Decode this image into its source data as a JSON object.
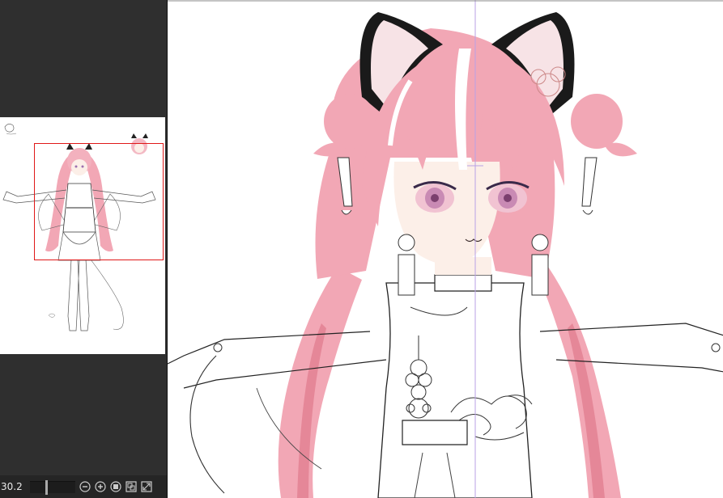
{
  "navigator": {
    "zoom_value": "30.2",
    "zoom_level": 0.36,
    "icons": [
      "zoom-out-icon",
      "zoom-in-icon",
      "fit-icon",
      "actual-size-icon",
      "fit-window-icon"
    ]
  },
  "colors": {
    "panel_bg": "#2f2f2f",
    "canvas_bg": "#ffffff",
    "navigator_frame": "#e01818",
    "hair_pink": "#f2a7b5",
    "hair_shadow": "#e58798",
    "guide_line": "#b9a0e6",
    "ear_black": "#1a1a1a",
    "skin": "#fcefe8"
  }
}
